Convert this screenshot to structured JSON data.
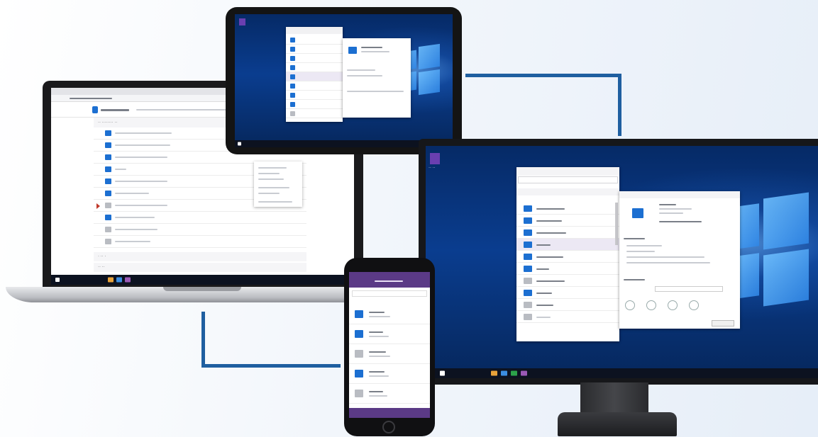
{
  "scene": {
    "accent_color": "#1f5fa0",
    "app_purple": "#5b3a86",
    "device_blue": "#1c6fd1",
    "devices": [
      "laptop",
      "tablet",
      "monitor",
      "phone"
    ]
  },
  "laptop": {
    "section_label": "·· ········ ··",
    "group_a_label": "· ·· ·",
    "group_b_label": "·· ··"
  },
  "monitor": {
    "desktop_icon_label": "·· ··"
  }
}
